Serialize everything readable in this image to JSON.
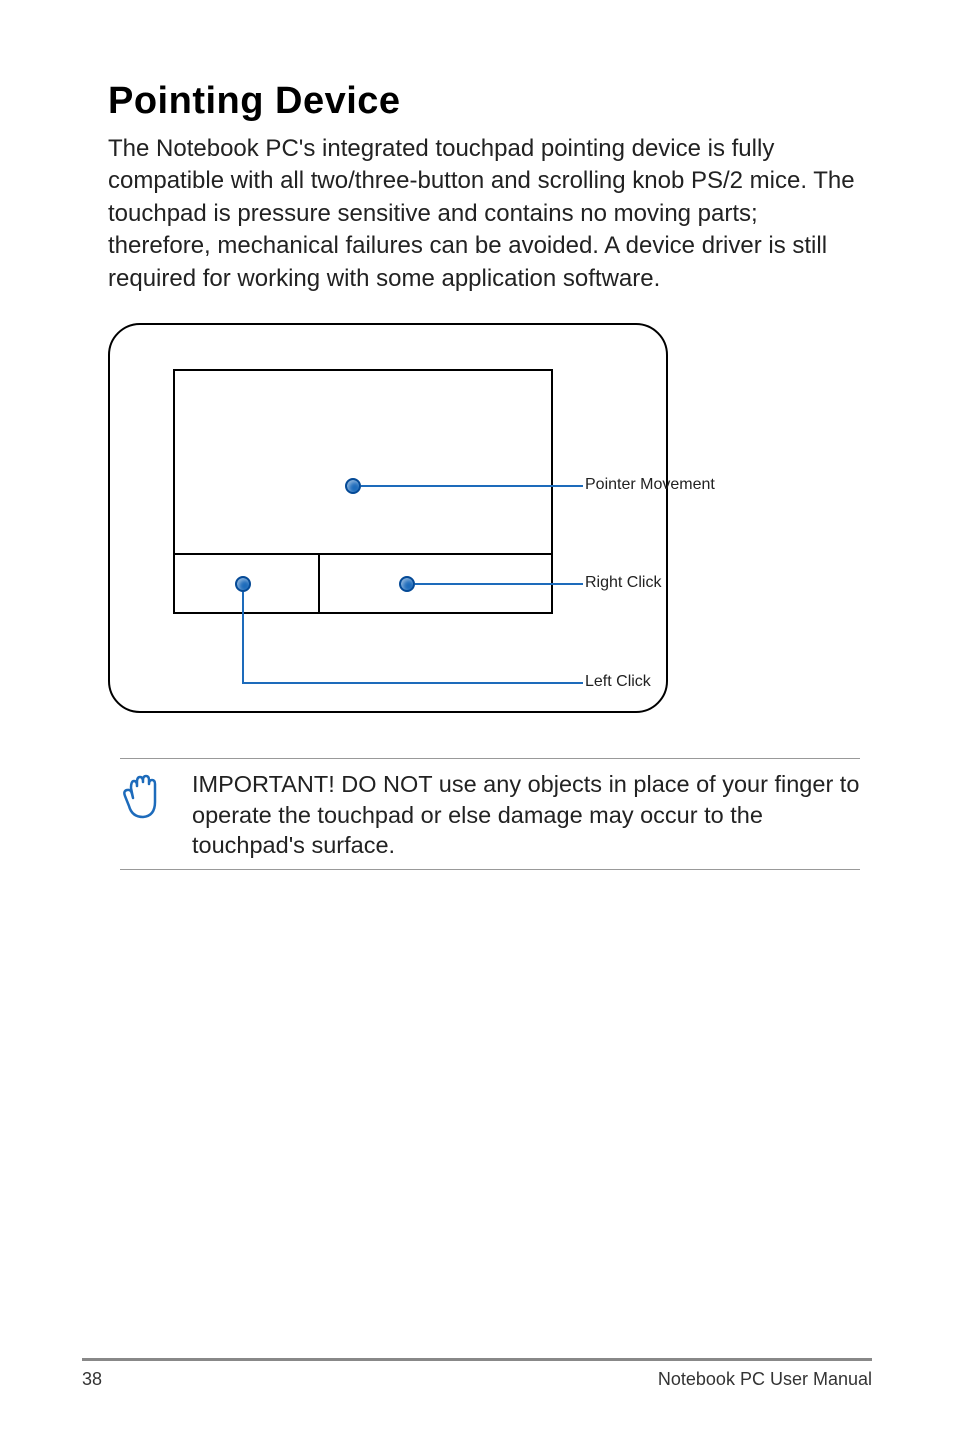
{
  "heading": "Pointing Device",
  "body": "The Notebook PC's integrated touchpad pointing device is fully compatible with all two/three-button and scrolling knob PS/2 mice. The touchpad is pressure sensitive and contains no moving parts; therefore, mechanical failures can be avoided. A device driver is still required for working with some application software.",
  "diagram": {
    "labels": {
      "pointer_movement": "Pointer Movement",
      "right_click": "Right Click",
      "left_click": "Left Click"
    }
  },
  "note": "IMPORTANT! DO NOT use any objects in place of your finger to operate the touchpad or else damage may occur to the touchpad's surface.",
  "footer": {
    "page_number": "38",
    "manual_title": "Notebook PC User Manual"
  }
}
